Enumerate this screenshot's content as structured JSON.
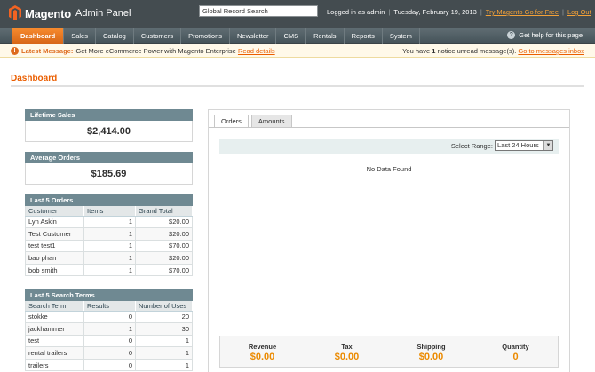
{
  "header": {
    "logo": "Magento",
    "logo_sub": "Admin Panel",
    "search_value": "Global Record Search",
    "logged_in": "Logged in as admin",
    "date": "Tuesday, February 19, 2013",
    "try_link": "Try Magento Go for Free",
    "logout": "Log Out"
  },
  "nav": {
    "items": [
      "Dashboard",
      "Sales",
      "Catalog",
      "Customers",
      "Promotions",
      "Newsletter",
      "CMS",
      "Rentals",
      "Reports",
      "System"
    ],
    "help": "Get help for this page"
  },
  "message": {
    "label": "Latest Message:",
    "text": "Get More eCommerce Power with Magento Enterprise",
    "read_details": "Read details",
    "notice_pre": "You have",
    "notice_count": "1",
    "notice_post": "notice unread message(s).",
    "go_link": "Go to messages inbox"
  },
  "page": {
    "title": "Dashboard"
  },
  "lifetime_sales": {
    "title": "Lifetime Sales",
    "value": "$2,414.00"
  },
  "average_orders": {
    "title": "Average Orders",
    "value": "$185.69"
  },
  "last_orders": {
    "title": "Last 5 Orders",
    "columns": [
      "Customer",
      "Items",
      "Grand Total"
    ],
    "rows": [
      [
        "Lyn Askin",
        "1",
        "$20.00"
      ],
      [
        "Test Customer",
        "1",
        "$20.00"
      ],
      [
        "test test1",
        "1",
        "$70.00"
      ],
      [
        "bao phan",
        "1",
        "$20.00"
      ],
      [
        "bob smith",
        "1",
        "$70.00"
      ]
    ]
  },
  "search_terms": {
    "title": "Last 5 Search Terms",
    "columns": [
      "Search Term",
      "Results",
      "Number of Uses"
    ],
    "rows": [
      [
        "stokke",
        "0",
        "20"
      ],
      [
        "jackhammer",
        "1",
        "30"
      ],
      [
        "test",
        "0",
        "1"
      ],
      [
        "rental trailers",
        "0",
        "1"
      ],
      [
        "trailers",
        "0",
        "1"
      ]
    ]
  },
  "panel": {
    "tabs": [
      "Orders",
      "Amounts"
    ],
    "range_label": "Select Range:",
    "range_value": "Last 24 Hours",
    "no_data": "No Data Found",
    "totals": [
      {
        "label": "Revenue",
        "value": "$0.00"
      },
      {
        "label": "Tax",
        "value": "$0.00"
      },
      {
        "label": "Shipping",
        "value": "$0.00"
      },
      {
        "label": "Quantity",
        "value": "0"
      }
    ]
  },
  "colors": {
    "accent": "#eb5e00",
    "nav_active": "#e8761f",
    "header_bg": "#444c50",
    "box_head": "#6f8992"
  }
}
